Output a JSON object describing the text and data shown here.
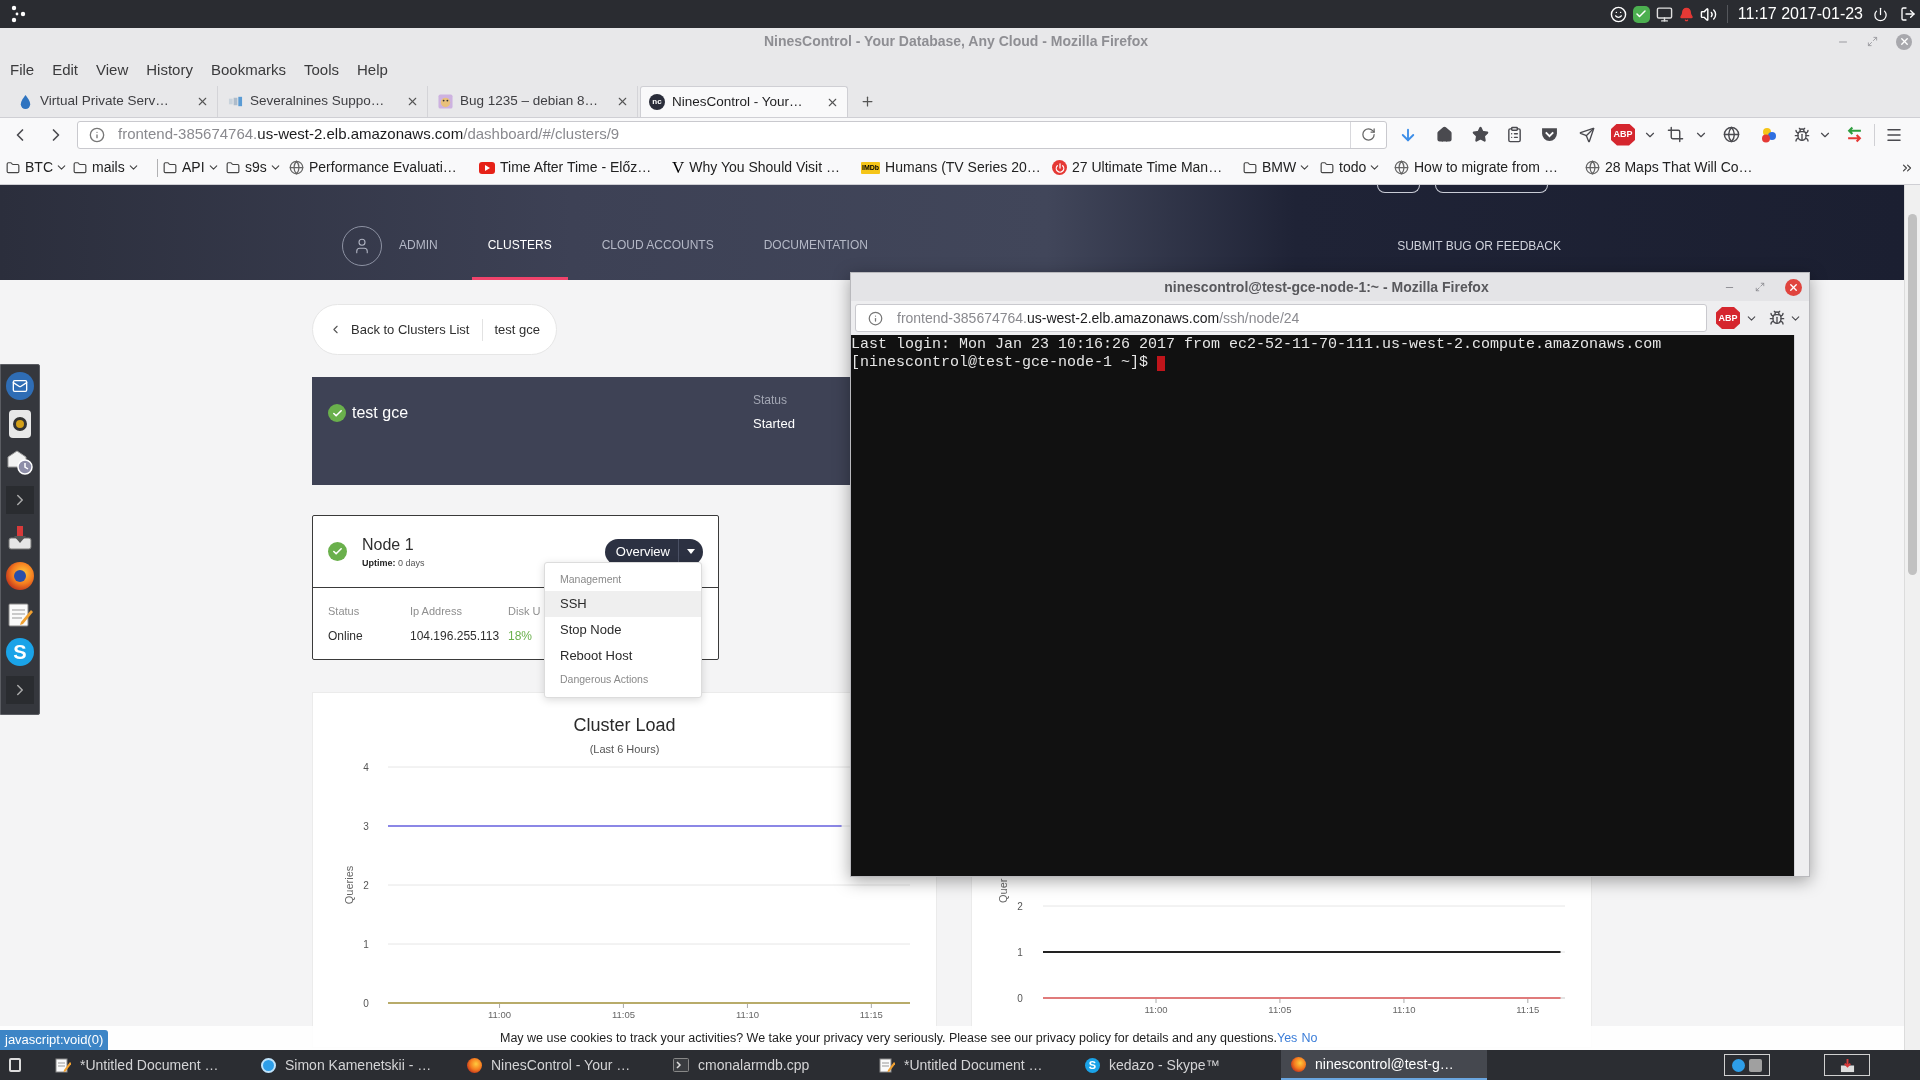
{
  "system_panel": {
    "clock": "11:17 2017-01-23"
  },
  "window": {
    "title": "NinesControl - Your Database, Any Cloud - Mozilla Firefox"
  },
  "menu": [
    "File",
    "Edit",
    "View",
    "History",
    "Bookmarks",
    "Tools",
    "Help"
  ],
  "tabs": [
    {
      "label": "Virtual Private Serv…",
      "selected": false
    },
    {
      "label": "Severalnines Suppo…",
      "selected": false
    },
    {
      "label": "Bug 1235 – debian 8…",
      "selected": false
    },
    {
      "label": "NinesControl - Your…",
      "selected": true,
      "favicon_text": "nc"
    }
  ],
  "address_bar": {
    "url_parts": [
      {
        "text": "frontend-385674764.",
        "muted": true
      },
      {
        "text": "us-west-2.elb.amazonaws.com",
        "muted": false
      },
      {
        "text": "/dashboard/#/clusters/9",
        "muted": true
      }
    ]
  },
  "toolbar": {
    "adblock_label": "ABP"
  },
  "bookmarks": [
    {
      "kind": "folder",
      "label": "BTC"
    },
    {
      "kind": "folder",
      "label": "mails"
    },
    {
      "kind": "separator"
    },
    {
      "kind": "folder",
      "label": "API"
    },
    {
      "kind": "folder",
      "label": "s9s"
    },
    {
      "kind": "globe",
      "label": "Performance Evaluati…"
    },
    {
      "kind": "video",
      "label": "Time After Time - Előz…"
    },
    {
      "kind": "letter",
      "favicon_text": "V",
      "label": "Why You Should Visit …"
    },
    {
      "kind": "tag",
      "favicon_text": "IMDb",
      "label": "Humans (TV Series 20…"
    },
    {
      "kind": "power",
      "label": "27 Ultimate Time Man…"
    },
    {
      "kind": "folder",
      "label": "BMW"
    },
    {
      "kind": "folder",
      "label": "todo"
    },
    {
      "kind": "globe",
      "label": "How to migrate from …"
    },
    {
      "kind": "globe",
      "label": "28 Maps That Will Co…"
    }
  ],
  "page": {
    "nav": [
      {
        "label": "ADMIN",
        "selected": false
      },
      {
        "label": "CLUSTERS",
        "selected": true
      },
      {
        "label": "CLOUD ACCOUNTS",
        "selected": false
      },
      {
        "label": "DOCUMENTATION",
        "selected": false
      }
    ],
    "feedback_link": "SUBMIT BUG OR FEEDBACK",
    "breadcrumb": {
      "back": "Back to Clusters List",
      "current": "test gce"
    },
    "cluster": {
      "name": "test gce",
      "status_label": "Status",
      "status": "Started"
    },
    "node": {
      "name": "Node 1",
      "uptime": "**Uptime:** 0 days",
      "button": "Overview",
      "fields": [
        {
          "label": "Status",
          "value": "Online",
          "color": "#2f2f2f"
        },
        {
          "label": "Ip Address",
          "value": "104.196.255.113",
          "color": "#2f2f2f"
        },
        {
          "label": "Disk U",
          "value": "18%",
          "color": "#6ab04c"
        }
      ]
    },
    "node_menu": [
      {
        "kind": "header",
        "label": "Management"
      },
      {
        "kind": "action",
        "label": "SSH",
        "selected": true
      },
      {
        "kind": "action",
        "label": "Stop Node",
        "selected": false
      },
      {
        "kind": "action",
        "label": "Reboot Host",
        "selected": false
      },
      {
        "kind": "header",
        "label": "Dangerous Actions"
      }
    ],
    "charts": [
      {
        "chart_data": {
          "type": "line",
          "title": "Cluster Load",
          "subtitle": "(Last 6 Hours)",
          "ylabel": "Queries",
          "yticks": [
            0,
            1,
            2,
            3,
            4
          ],
          "ylim": [
            0,
            4
          ],
          "xticks": [
            {
              "value": 11,
              "label": "11:00"
            },
            {
              "value": 11.0833,
              "label": "11:05"
            },
            {
              "value": 11.1667,
              "label": "11:10"
            },
            {
              "value": 11.25,
              "label": "11:15"
            }
          ],
          "xlim": [
            10.925,
            11.276
          ],
          "grid": true,
          "series": [
            {
              "color": "#8b87e6",
              "x": [
                10.925,
                11.23
              ],
              "values": [
                3,
                3
              ]
            },
            {
              "color": "#b8ab6a",
              "x": [
                10.925,
                11.276
              ],
              "values": [
                0,
                0
              ]
            }
          ]
        }
      },
      {
        "chart_data": {
          "type": "line",
          "ylabel": "Quer",
          "yticks": [
            0,
            1,
            2
          ],
          "ylim": [
            0,
            2
          ],
          "xticks": [
            {
              "value": 11,
              "label": "11:00"
            },
            {
              "value": 11.0833,
              "label": "11:05"
            },
            {
              "value": 11.1667,
              "label": "11:10"
            },
            {
              "value": 11.25,
              "label": "11:15"
            }
          ],
          "xlim": [
            10.924,
            11.275
          ],
          "grid": true,
          "series": [
            {
              "color": "#222222",
              "x": [
                10.924,
                11.272
              ],
              "values": [
                1,
                1
              ]
            },
            {
              "color": "#e07b7b",
              "x": [
                10.924,
                11.272
              ],
              "values": [
                0,
                0
              ]
            }
          ]
        }
      }
    ]
  },
  "terminal_window": {
    "title": "ninescontrol@test-gce-node-1:~ - Mozilla Firefox",
    "url_parts": [
      {
        "text": "frontend-385674764.",
        "muted": true
      },
      {
        "text": "us-west-2.elb.amazonaws.com",
        "muted": false
      },
      {
        "text": "/ssh/node/24",
        "muted": true
      }
    ],
    "adblock_label": "ABP",
    "lines": [
      "Last login: Mon Jan 23 10:16:26 2017 from ec2-52-11-70-111.us-west-2.compute.amazonaws.com",
      "[ninescontrol@test-gce-node-1 ~]$"
    ]
  },
  "status_link": "javascript:void(0)",
  "cookie_banner": {
    "text": "May we use cookies to track your activities? We take your privacy very seriously. Please see our privacy policy for details and any questions.",
    "accept": "Yes",
    "decline": "No"
  },
  "dock": [
    {
      "kind": "mail"
    },
    {
      "kind": "speaker"
    },
    {
      "kind": "schedule"
    },
    {
      "kind": "expander"
    },
    {
      "kind": "download"
    },
    {
      "kind": "browser"
    },
    {
      "kind": "notes"
    },
    {
      "kind": "letter",
      "icon_text": "S"
    },
    {
      "kind": "expander"
    }
  ],
  "taskbar": {
    "items": [
      {
        "kind": "notes",
        "label": "*Untitled Document …",
        "selected": false
      },
      {
        "kind": "chat",
        "label": "Simon Kamenetskii - …",
        "selected": false
      },
      {
        "kind": "browser",
        "label": "NinesControl - Your …",
        "selected": false
      },
      {
        "kind": "terminal",
        "label": "cmonalarmdb.cpp",
        "selected": false
      },
      {
        "kind": "notes",
        "label": "*Untitled Document …",
        "selected": false
      },
      {
        "kind": "letter",
        "icon_text": "S",
        "label": "kedazo - Skype™",
        "selected": false
      },
      {
        "kind": "browser",
        "label": "ninescontrol@test-g…",
        "selected": true
      }
    ]
  }
}
